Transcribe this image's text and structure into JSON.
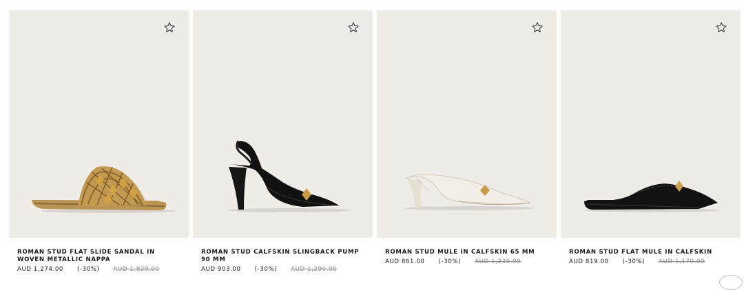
{
  "products": [
    {
      "name": "ROMAN STUD FLAT SLIDE SANDAL IN WOVEN METALLIC NAPPA",
      "price": "AUD 1,274.00",
      "discount": "(-30%)",
      "old_price": "AUD 1,820.00",
      "wishlist_icon": "star-outline-icon"
    },
    {
      "name": "ROMAN STUD CALFSKIN SLINGBACK PUMP 90 MM",
      "price": "AUD 903.00",
      "discount": "(-30%)",
      "old_price": "AUD 1,290.00",
      "wishlist_icon": "star-outline-icon"
    },
    {
      "name": "ROMAN STUD MULE IN CALFSKIN 65 MM",
      "price": "AUD 861.00",
      "discount": "(-30%)",
      "old_price": "AUD 1,230.00",
      "wishlist_icon": "star-outline-icon"
    },
    {
      "name": "ROMAN STUD FLAT MULE IN CALFSKIN",
      "price": "AUD 819.00",
      "discount": "(-30%)",
      "old_price": "AUD 1,170.00",
      "wishlist_icon": "star-outline-icon"
    }
  ],
  "colors": {
    "image_bg": "#efece8",
    "text": "#1a1a1a",
    "old_price": "#8a8a8a"
  }
}
